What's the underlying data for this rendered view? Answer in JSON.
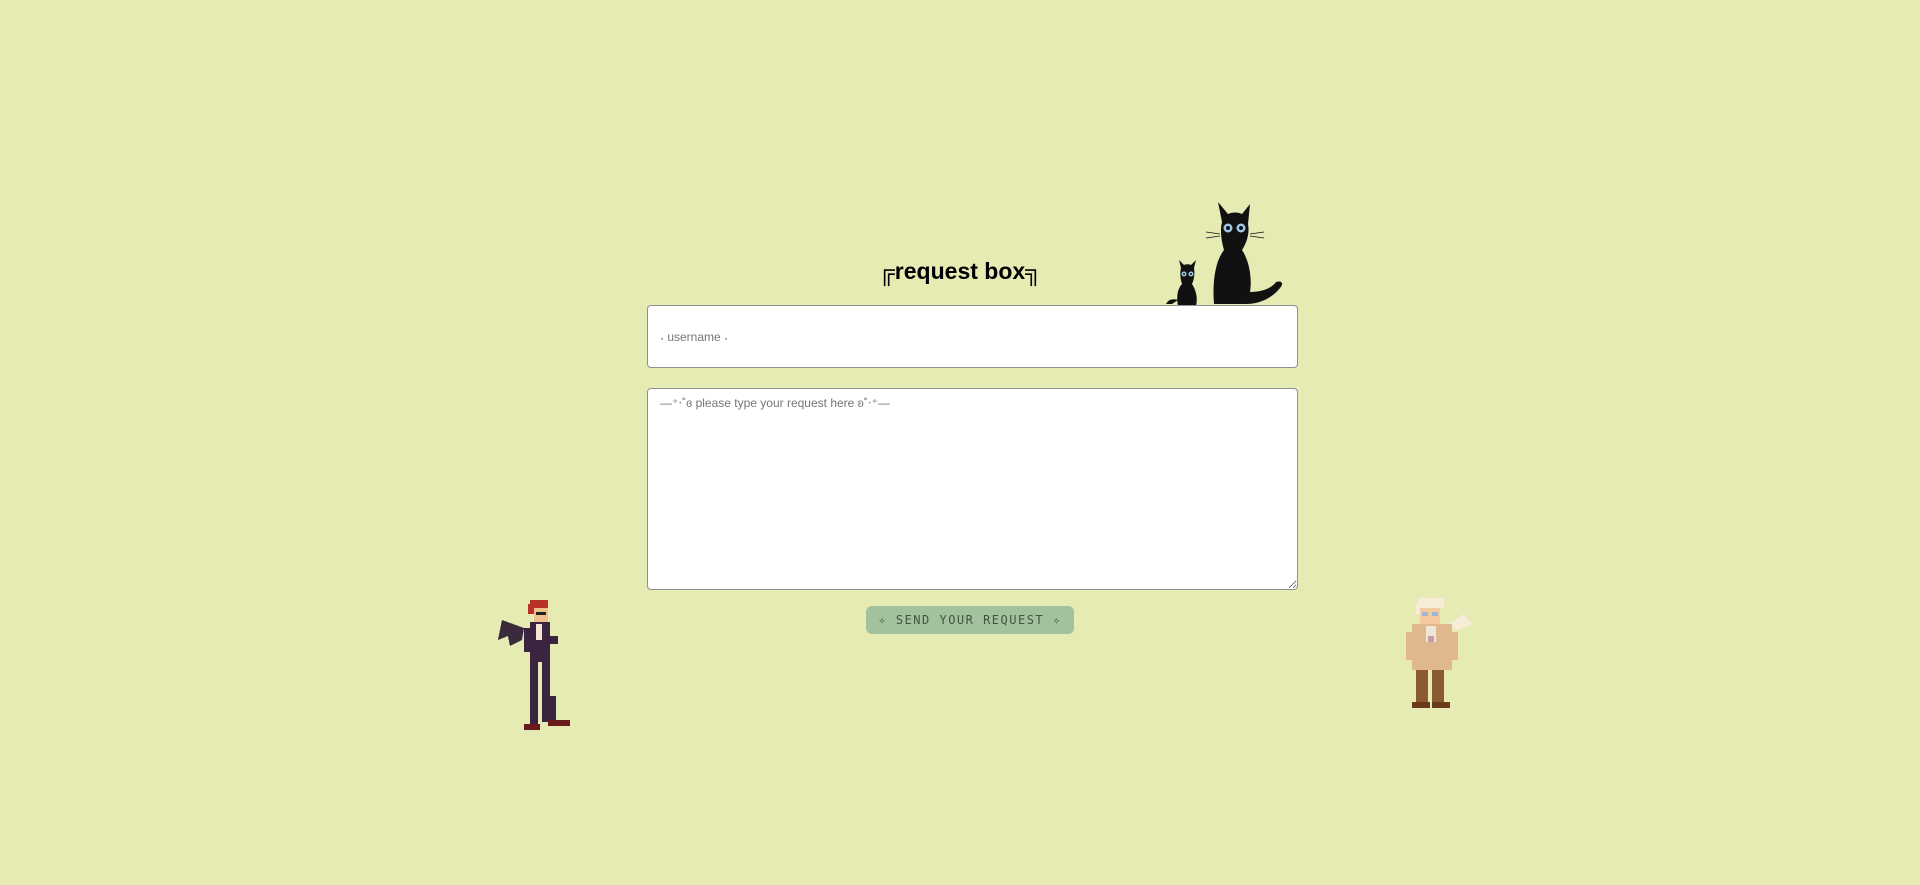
{
  "title": "╔request box╗",
  "form": {
    "username_placeholder": "˖ username ˖",
    "username_value": "",
    "request_placeholder": "—⁺‧˚ɞ please type your request here ʚ˚‧⁺—",
    "request_value": "",
    "send_label": "✧ SEND YOUR REQUEST ✧"
  },
  "colors": {
    "background": "#e6ebb4",
    "button_bg": "#a4c19e",
    "button_text": "#3f5540"
  }
}
